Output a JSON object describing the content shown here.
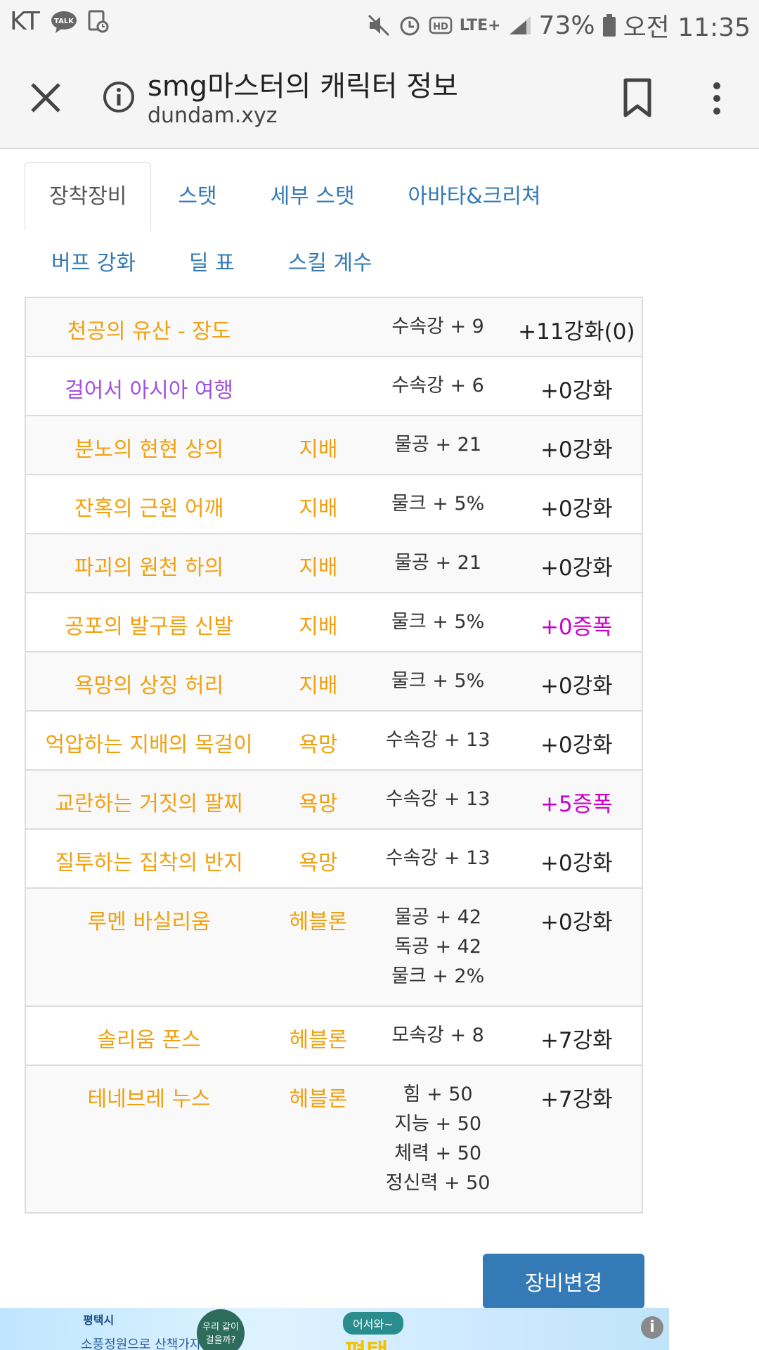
{
  "status_bar": {
    "carrier": "KT",
    "talk_badge": "TALK",
    "battery": "73%",
    "time": "오전 11:35",
    "network": "LTE+"
  },
  "header": {
    "title": "smg마스터의 캐릭터 정보",
    "url": "dundam.xyz"
  },
  "tabs_row1": [
    "장착장비",
    "스탯",
    "세부 스탯",
    "아바타&크리쳐"
  ],
  "tabs_row2": [
    "버프 강화",
    "딜 표",
    "스킬 계수"
  ],
  "equipment": [
    {
      "name": "천공의 유산 - 장도",
      "name_color": "orange",
      "set": "",
      "options": [
        "수속강 + 9"
      ],
      "enhance": "+11강화(0)",
      "enhance_color": "normal"
    },
    {
      "name": "걸어서 아시아 여행",
      "name_color": "purple",
      "set": "",
      "options": [
        "수속강 + 6"
      ],
      "enhance": "+0강화",
      "enhance_color": "normal"
    },
    {
      "name": "분노의 현현 상의",
      "name_color": "orange",
      "set": "지배",
      "options": [
        "물공 + 21"
      ],
      "enhance": "+0강화",
      "enhance_color": "normal"
    },
    {
      "name": "잔혹의 근원 어깨",
      "name_color": "orange",
      "set": "지배",
      "options": [
        "물크 + 5%"
      ],
      "enhance": "+0강화",
      "enhance_color": "normal"
    },
    {
      "name": "파괴의 원천 하의",
      "name_color": "orange",
      "set": "지배",
      "options": [
        "물공 + 21"
      ],
      "enhance": "+0강화",
      "enhance_color": "normal"
    },
    {
      "name": "공포의 발구름 신발",
      "name_color": "orange",
      "set": "지배",
      "options": [
        "물크 + 5%"
      ],
      "enhance": "+0증폭",
      "enhance_color": "magenta"
    },
    {
      "name": "욕망의 상징 허리",
      "name_color": "orange",
      "set": "지배",
      "options": [
        "물크 + 5%"
      ],
      "enhance": "+0강화",
      "enhance_color": "normal"
    },
    {
      "name": "억압하는 지배의 목걸이",
      "name_color": "orange",
      "set": "욕망",
      "options": [
        "수속강 + 13"
      ],
      "enhance": "+0강화",
      "enhance_color": "normal"
    },
    {
      "name": "교란하는 거짓의 팔찌",
      "name_color": "orange",
      "set": "욕망",
      "options": [
        "수속강 + 13"
      ],
      "enhance": "+5증폭",
      "enhance_color": "magenta"
    },
    {
      "name": "질투하는 집착의 반지",
      "name_color": "orange",
      "set": "욕망",
      "options": [
        "수속강 + 13"
      ],
      "enhance": "+0강화",
      "enhance_color": "normal"
    },
    {
      "name": "루멘 바실리움",
      "name_color": "orange",
      "set": "헤블론",
      "options": [
        "물공 + 42",
        "독공 + 42",
        "물크 + 2%"
      ],
      "enhance": "+0강화",
      "enhance_color": "normal"
    },
    {
      "name": "솔리움 폰스",
      "name_color": "orange",
      "set": "헤블론",
      "options": [
        "모속강 + 8"
      ],
      "enhance": "+7강화",
      "enhance_color": "normal"
    },
    {
      "name": "테네브레 누스",
      "name_color": "orange",
      "set": "헤블론",
      "options": [
        "힘 + 50",
        "지능 + 50",
        "체력 + 50",
        "정신력 + 50"
      ],
      "enhance": "+7강화",
      "enhance_color": "normal"
    }
  ],
  "change_button": "장비변경",
  "ad": {
    "org": "평택시",
    "slogan": "소풍정원으로 산책가자!",
    "circle": "우리 같이 걸을까?",
    "bubble": "어서와~",
    "big": "평택",
    "info": "i"
  }
}
